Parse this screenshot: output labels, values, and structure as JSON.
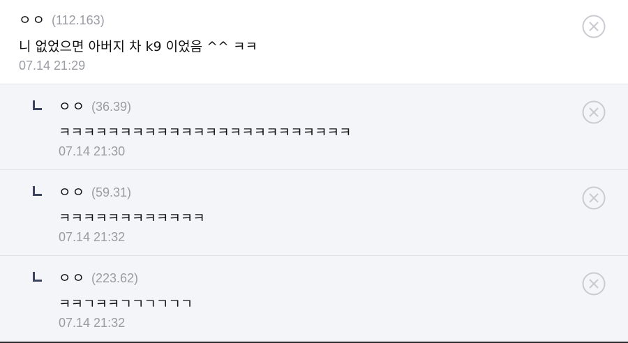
{
  "comments": [
    {
      "nick": "ㅇㅇ",
      "ip": "(112.163)",
      "text": "니 없었으면 아버지 차 k9 이었음 ^^ ㅋㅋ",
      "date": "07.14 21:29"
    },
    {
      "nick": "ㅇㅇ",
      "ip": "(36.39)",
      "text": "ㅋㅋㅋㅋㅋㅋㅋㅋㅋㅋㅋㅋㅋㅋㅋㅋㅋㅋㅋㅋㅋㅋㅋㅋ",
      "date": "07.14 21:30"
    },
    {
      "nick": "ㅇㅇ",
      "ip": "(59.31)",
      "text": "ㅋㅋㅋㅋㅋㅋㅋㅋㅋㅋㅋㅋ",
      "date": "07.14 21:32"
    },
    {
      "nick": "ㅇㅇ",
      "ip": "(223.62)",
      "text": "ㅋㅋㄱㅋㅋㄱㄱㄱㄱㄱㄱ",
      "date": "07.14 21:32"
    }
  ],
  "icons": {
    "reply": "reply-corner-icon",
    "delete": "close-circle-icon"
  },
  "colors": {
    "reply_bg": "#f4f5f8",
    "meta_gray": "#9a9ca3",
    "icon_gray": "#c9cbd0",
    "reply_mark": "#3c4460"
  }
}
